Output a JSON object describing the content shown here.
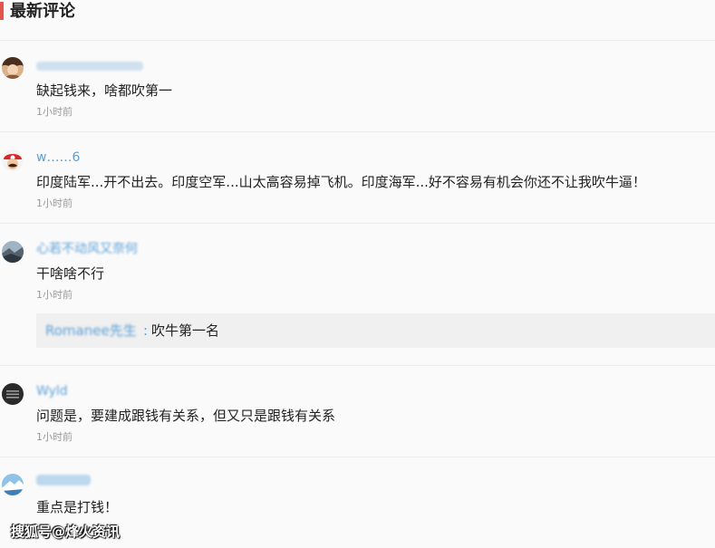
{
  "section": {
    "title": "最新评论"
  },
  "comments": [
    {
      "username": "",
      "content": "缺起钱来，啥都吹第一",
      "time": "1小时前",
      "avatar_icon": "anime-avatar-icon"
    },
    {
      "username": "w……6",
      "content": "印度陆军...开不出去。印度空军...山太高容易掉飞机。印度海军...好不容易有机会你还不让我吹牛逼！",
      "time": "1小时前",
      "avatar_icon": "mario-avatar-icon"
    },
    {
      "username": "心若不动风又奈何",
      "content": "干啥啥不行",
      "time": "1小时前",
      "avatar_icon": "landscape-avatar-icon",
      "reply": {
        "username": "Romanee先生",
        "separator": ":",
        "content": "吹牛第一名"
      }
    },
    {
      "username": "Wyld",
      "content": "问题是，要建成跟钱有关系，但又只是跟钱有关系",
      "time": "1小时前",
      "avatar_icon": "text-avatar-icon"
    },
    {
      "username": "",
      "content": "重点是打钱！",
      "time": "",
      "avatar_icon": "mountain-avatar-icon"
    }
  ],
  "watermark": "搜狐号@烽火资讯",
  "colors": {
    "accent_bar": "#e5544a",
    "username": "#5a9fd6",
    "text": "#222222",
    "time": "#9a9a9a"
  }
}
